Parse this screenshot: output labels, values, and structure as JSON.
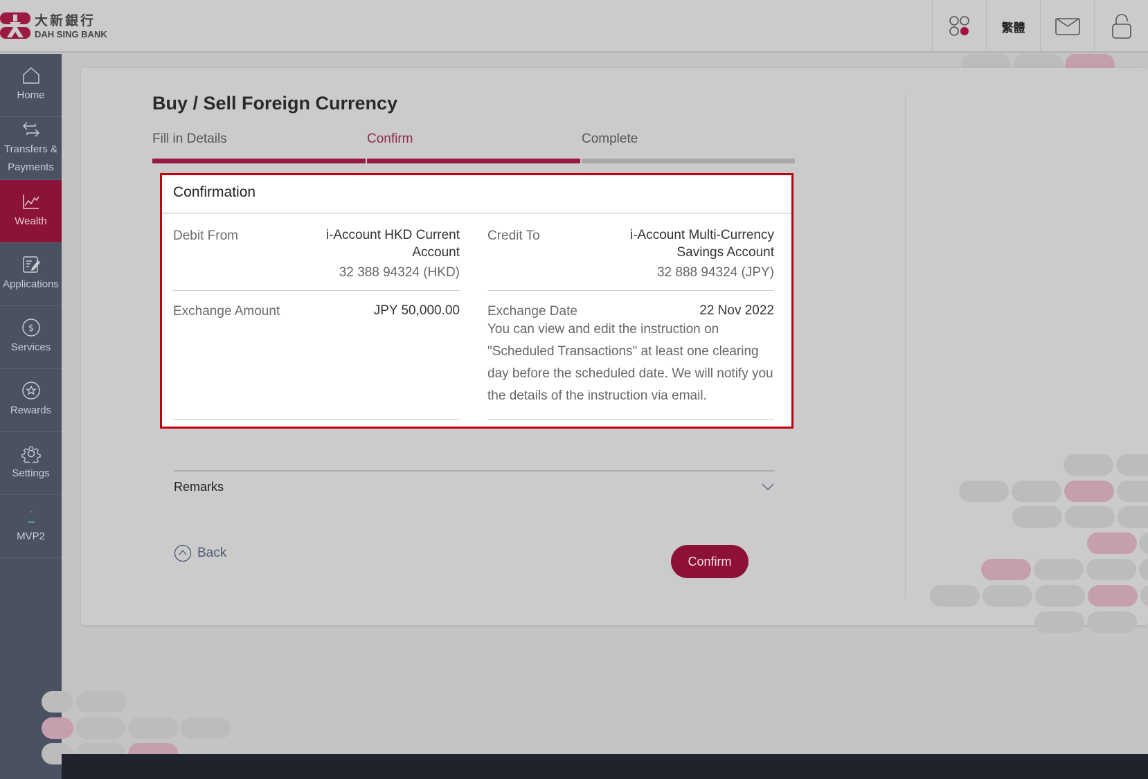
{
  "header": {
    "brand_cn": "大新銀行",
    "brand_en": "DAH SING BANK",
    "actions": [
      {
        "name": "apps",
        "icon": "apps-grid-icon"
      },
      {
        "name": "language",
        "label": "繁體"
      },
      {
        "name": "messages",
        "icon": "mail-icon"
      },
      {
        "name": "logout",
        "icon": "unlock-icon"
      }
    ]
  },
  "sidebar": {
    "items": [
      {
        "label": "Home",
        "icon": "home-icon",
        "active": false
      },
      {
        "label": "Transfers & Payments",
        "icon": "transfer-arrows-icon",
        "active": false
      },
      {
        "label": "Wealth",
        "icon": "chart-line-icon",
        "active": true
      },
      {
        "label": "Applications",
        "icon": "edit-form-icon",
        "active": false
      },
      {
        "label": "Services",
        "icon": "dollar-circle-icon",
        "active": false
      },
      {
        "label": "Rewards",
        "icon": "star-circle-icon",
        "active": false
      },
      {
        "label": "Settings",
        "icon": "gear-icon",
        "active": false
      },
      {
        "label": "MVP2",
        "icon": "mvp-icon",
        "active": false
      }
    ]
  },
  "page": {
    "title": "Buy / Sell Foreign Currency",
    "steps": [
      {
        "label": "Fill in Details",
        "state": "done"
      },
      {
        "label": "Confirm",
        "state": "current"
      },
      {
        "label": "Complete",
        "state": "pending"
      }
    ]
  },
  "confirmation": {
    "title": "Confirmation",
    "debit_from": {
      "label": "Debit From",
      "account_name_line1": "i-Account HKD Current",
      "account_name_line2": "Account",
      "account_number": "32 388 94324 (HKD)"
    },
    "credit_to": {
      "label": "Credit To",
      "account_name_line1": "i-Account Multi-Currency",
      "account_name_line2": "Savings Account",
      "account_number": "32 888 94324 (JPY)"
    },
    "exchange_amount": {
      "label": "Exchange Amount",
      "value": "JPY 50,000.00"
    },
    "exchange_date": {
      "label": "Exchange Date",
      "value": "22 Nov 2022",
      "note": "You can view and edit the instruction on \"Scheduled Transactions\" at least one clearing day before the scheduled date. We will notify you the details of the instruction via email."
    }
  },
  "remarks": {
    "label": "Remarks"
  },
  "actions": {
    "back_label": "Back",
    "confirm_label": "Confirm"
  },
  "colors": {
    "brand": "#8d1137",
    "highlight_border": "#c2000b",
    "sidebar_bg": "#4a5161",
    "step_pending": "#a9a9a9"
  }
}
